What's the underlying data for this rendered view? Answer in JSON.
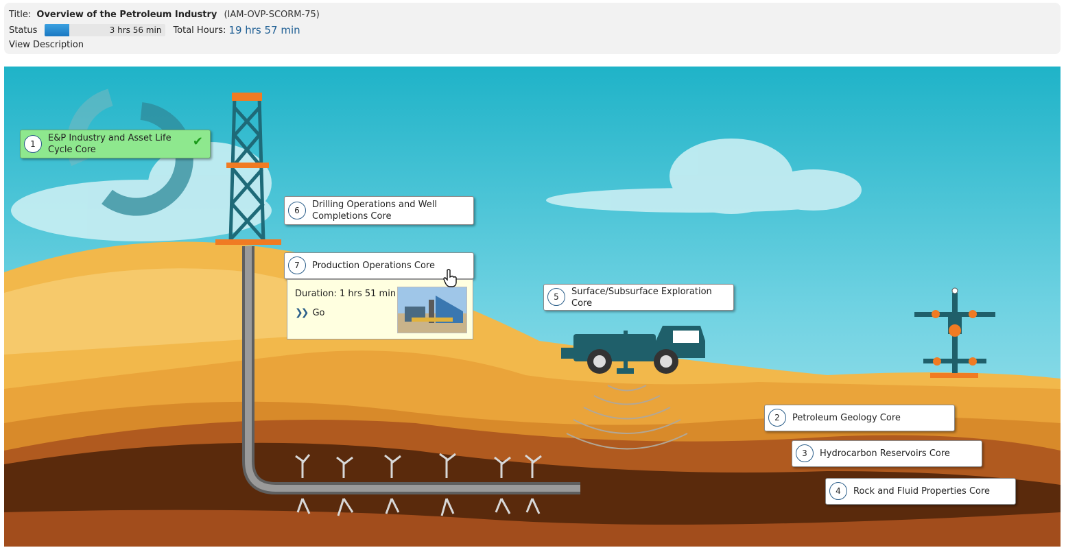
{
  "header": {
    "title_label": "Title:",
    "title": "Overview of the Petroleum Industry",
    "code": "(IAM-OVP-SCORM-75)",
    "status_label": "Status",
    "progress_fraction": 0.2,
    "progress_text": "3 hrs 56 min",
    "total_label": "Total Hours:",
    "total_value": "19 hrs 57 min",
    "view_description": "View Description"
  },
  "modules": [
    {
      "num": "1",
      "label": "E&P Industry and Asset Life Cycle Core",
      "completed": true
    },
    {
      "num": "6",
      "label": "Drilling Operations and Well Completions Core"
    },
    {
      "num": "7",
      "label": "Production Operations Core"
    },
    {
      "num": "5",
      "label": "Surface/Subsurface Exploration Core"
    },
    {
      "num": "2",
      "label": "Petroleum Geology Core"
    },
    {
      "num": "3",
      "label": "Hydrocarbon Reservoirs Core"
    },
    {
      "num": "4",
      "label": "Rock and Fluid Properties Core"
    }
  ],
  "popup": {
    "duration": "Duration: 1 hrs 51 min",
    "go_label": "Go",
    "go_icon": "double-chevron-right-icon"
  },
  "colors": {
    "completed": "#8ee88e",
    "accent": "#1f5f94",
    "sky": "#4fc3d8",
    "sand": "#f2b84b",
    "soil": "#5a2a0c"
  }
}
